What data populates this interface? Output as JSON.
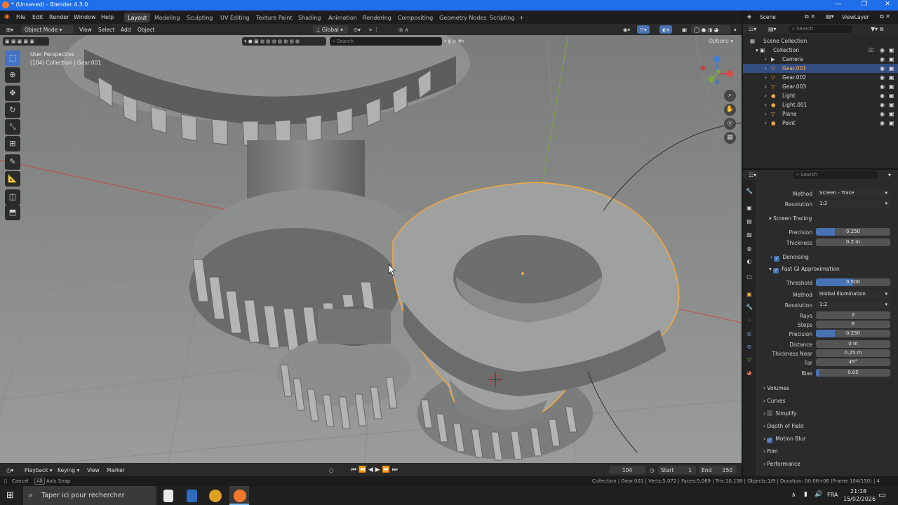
{
  "window": {
    "title": "* (Unsaved) - Blender 4.3.0",
    "controls": [
      "—",
      "❐",
      "✕"
    ]
  },
  "menubar": {
    "menus": [
      "File",
      "Edit",
      "Render",
      "Window",
      "Help"
    ],
    "workspaces": [
      "Layout",
      "Modeling",
      "Sculpting",
      "UV Editing",
      "Texture Paint",
      "Shading",
      "Animation",
      "Rendering",
      "Compositing",
      "Geometry Nodes",
      "Scripting"
    ],
    "add_workspace": "+",
    "scene_name": "Scene",
    "view_layer": "ViewLayer"
  },
  "header3d": {
    "mode": "Object Mode",
    "menus": [
      "View",
      "Select",
      "Add",
      "Object"
    ],
    "orientation": "Global",
    "search_placeholder": "Search",
    "options": "Options"
  },
  "viewport": {
    "perspective": "User Perspective",
    "collection_info": "(104) Collection | Gear.001",
    "colors": {
      "bg": "#6f7170",
      "gear": "#a9abaa",
      "selected_outline": "#f0a640",
      "x_axis": "#c44a4a",
      "y_axis": "#7ea63f"
    }
  },
  "tools": [
    "select-box",
    "cursor",
    "move",
    "rotate",
    "scale",
    "transform",
    "annotate",
    "measure",
    "add-cube",
    "add-cylinder"
  ],
  "outliner": {
    "search_placeholder": "Search",
    "scene_collection": "Scene Collection",
    "collection": "Collection",
    "items": [
      {
        "name": "Camera",
        "icon": "camera-icon"
      },
      {
        "name": "Gear.001",
        "icon": "mesh-icon",
        "selected": true
      },
      {
        "name": "Gear.002",
        "icon": "mesh-icon"
      },
      {
        "name": "Gear.003",
        "icon": "mesh-icon"
      },
      {
        "name": "Light",
        "icon": "light-icon"
      },
      {
        "name": "Light.001",
        "icon": "light-icon"
      },
      {
        "name": "Plane",
        "icon": "mesh-icon"
      },
      {
        "name": "Point",
        "icon": "light-icon"
      }
    ]
  },
  "properties": {
    "search_placeholder": "Search",
    "method1": {
      "label": "Method",
      "value": "Screen - Trace"
    },
    "resolution1": {
      "label": "Resolution",
      "value": "1:2"
    },
    "screen_tracing": "Screen Tracing",
    "precision1": {
      "label": "Precision",
      "value": "0.250",
      "fraction": 0.25
    },
    "thickness": {
      "label": "Thickness",
      "value": "0.2 m"
    },
    "denoising": "Denoising",
    "fast_gi": "Fast GI Approximation",
    "threshold": {
      "label": "Threshold",
      "value": "0.500",
      "fraction": 0.5
    },
    "method2": {
      "label": "Method",
      "value": "Global Illumination"
    },
    "resolution2": {
      "label": "Resolution",
      "value": "1:2"
    },
    "rays": {
      "label": "Rays",
      "value": "2"
    },
    "steps": {
      "label": "Steps",
      "value": "8"
    },
    "precision2": {
      "label": "Precision",
      "value": "0.250",
      "fraction": 0.25
    },
    "distance": {
      "label": "Distance",
      "value": "0 m"
    },
    "thickness_near": {
      "label": "Thickness Near",
      "value": "0.25 m"
    },
    "far": {
      "label": "Far",
      "value": "45°"
    },
    "bias": {
      "label": "Bias",
      "value": "0.05",
      "fraction": 0.05
    },
    "sections": [
      "Volumes",
      "Curves",
      "Simplify",
      "Depth of Field",
      "Motion Blur",
      "Film",
      "Performance"
    ]
  },
  "timeline": {
    "menus": [
      "Playback",
      "Keying",
      "View",
      "Marker"
    ],
    "current_frame": "104",
    "start_label": "Start",
    "start": "1",
    "end_label": "End",
    "end": "150"
  },
  "statusbar": {
    "left": "Cancel",
    "alt_key": "Alt",
    "axis_snap": "Axis Snap",
    "right": "Collection | Gear.001 | Verts:5,072 | Faces:5,069 | Tris:10,138 | Objects:1/9 | Duration: 00:06+06 (Frame 104/150) | 4."
  },
  "taskbar": {
    "search_placeholder": "Taper ici pour rechercher",
    "lang": "FRA",
    "time": "21:18",
    "date": "15/02/2026"
  }
}
